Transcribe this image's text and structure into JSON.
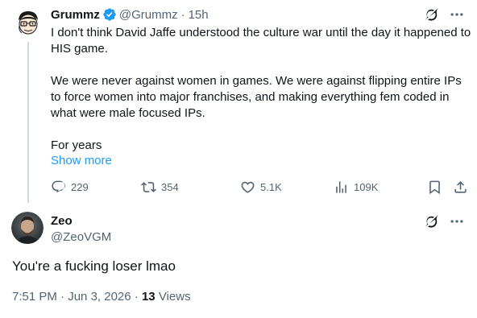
{
  "colors": {
    "accent": "#1d9bf0",
    "muted": "#536471",
    "text": "#0f1419",
    "line": "#cfd9de"
  },
  "parent": {
    "author_name": "Grummz",
    "verified": true,
    "handle": "@Grummz",
    "separator": "·",
    "time": "15h",
    "header_icons": [
      "grok-icon",
      "more-icon"
    ],
    "body": [
      "I don't think David Jaffe understood the culture war until the day it happened to HIS game.",
      "We were never against women in games. We were against flipping entire IPs to force women into major franchises, and making everything fem coded in what were male focused IPs.",
      "For years"
    ],
    "show_more": "Show more",
    "actions": {
      "replies": "229",
      "reposts": "354",
      "likes": "5.1K",
      "views": "109K"
    }
  },
  "reply": {
    "author_name": "Zeo",
    "handle": "@ZeoVGM",
    "header_icons": [
      "grok-icon",
      "more-icon"
    ],
    "text": "You're a fucking loser lmao",
    "meta": {
      "time": "7:51 PM",
      "separator": "·",
      "date": "Jun 3, 2026",
      "separator2": "·",
      "views_count": "13",
      "views_label": "Views"
    }
  }
}
